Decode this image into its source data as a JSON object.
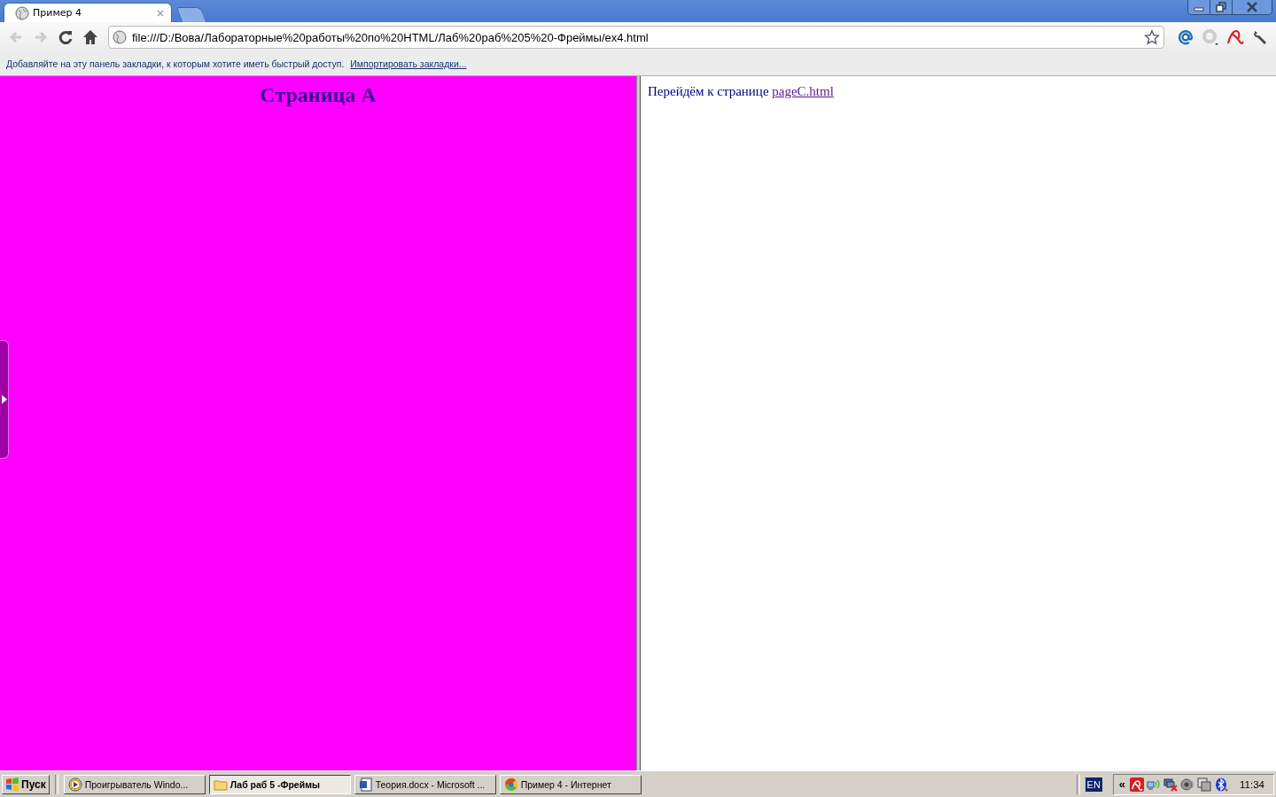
{
  "tabs": [
    {
      "title": "Пример 4",
      "selected": true
    }
  ],
  "address_bar": {
    "value": "file:///D:/Вова/Лабораторные%20работы%20по%20HTML/Лаб%20раб%205%20-Фреймы/ex4.html"
  },
  "bookmarks_bar": {
    "message": "Добавляйте на эту панель закладки, к которым хотите иметь быстрый доступ.",
    "link": "Импортировать закладки..."
  },
  "left_frame": {
    "heading": "Страница А"
  },
  "right_frame": {
    "text": "Перейдём к странице",
    "link": "pageC.html"
  },
  "taskbar": {
    "start": "Пуск",
    "tasks": [
      {
        "label": "Проигрыватель Windo...",
        "kind": "media",
        "selected": false
      },
      {
        "label": "Лаб раб 5 -Фреймы",
        "kind": "folder",
        "selected": true
      },
      {
        "label": "Теория.docx - Microsoft ...",
        "kind": "word",
        "selected": false
      },
      {
        "label": "Пример 4 - Интернет",
        "kind": "browser",
        "selected": false
      }
    ],
    "language": "EN",
    "tray_toggle": "«",
    "clock": "11:34"
  }
}
